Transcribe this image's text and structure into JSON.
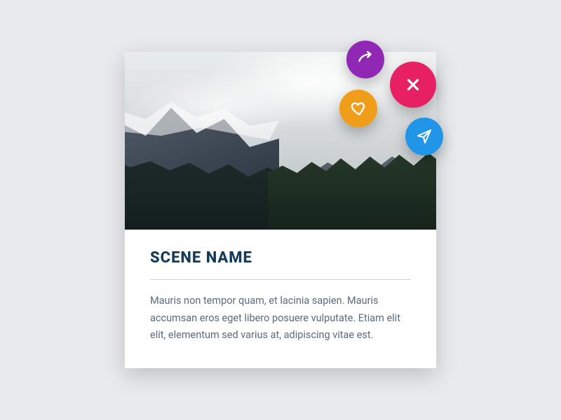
{
  "card": {
    "title": "SCENE NAME",
    "description": "Mauris non tempor quam, et lacinia sapien. Mauris accumsan eros eget libero posuere vulputate. Etiam elit elit, elementum sed varius at, adipiscing vitae est."
  },
  "actions": {
    "share": "share-icon",
    "close": "close-icon",
    "heart": "heart-icon",
    "send": "send-icon"
  },
  "colors": {
    "share": "#9128b5",
    "close": "#e71f63",
    "heart": "#f09d1a",
    "send": "#2196e9",
    "title": "#123a5b",
    "body": "#5a6b7b",
    "page_bg": "#e9eaee"
  }
}
